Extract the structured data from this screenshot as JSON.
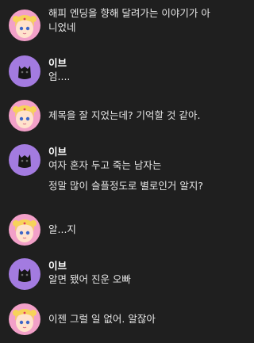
{
  "messages": [
    {
      "speaker": "girl",
      "name": "",
      "lines": [
        "해피 엔딩을 향해 달려가는 이야기가 아",
        "니었네"
      ]
    },
    {
      "speaker": "eve",
      "name": "이브",
      "lines": [
        "엄...."
      ]
    },
    {
      "speaker": "girl",
      "name": "",
      "lines": [
        "제목을 잘 지었는데? 기억할 것 같아."
      ]
    },
    {
      "speaker": "eve",
      "name": "이브",
      "lines": [
        "여자 혼자 두고 죽는 남자는",
        "정말 많이 슬플정도로 별로인거 알지?"
      ]
    },
    {
      "speaker": "girl",
      "name": "",
      "lines": [
        "알...지"
      ]
    },
    {
      "speaker": "eve",
      "name": "이브",
      "lines": [
        "알면 됐어 진운 오빠"
      ]
    },
    {
      "speaker": "girl",
      "name": "",
      "lines": [
        "이젠 그럴 일 없어. 알잖아"
      ]
    }
  ],
  "colors": {
    "background": "#1f1f1f",
    "girl_avatar_bg": "#f2a0c8",
    "eve_avatar_bg": "#a37be0"
  }
}
